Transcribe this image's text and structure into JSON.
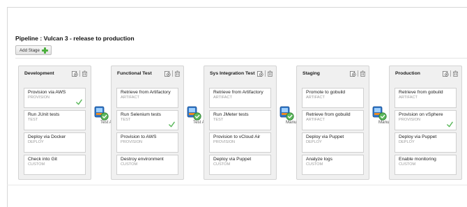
{
  "pipeline": {
    "title": "Pipeline : Vulcan 3 - release to production",
    "add_stage_label": "Add Stage"
  },
  "stages": [
    {
      "name": "Development",
      "tasks": [
        {
          "name": "Provision via AWS",
          "type": "PROVISION",
          "status": "success"
        },
        {
          "name": "Run JUnit tests",
          "type": "TEST",
          "status": ""
        },
        {
          "name": "Deploy via Docker",
          "type": "DEPLOY",
          "status": ""
        },
        {
          "name": "Check into Git",
          "type": "CUSTOM",
          "status": ""
        }
      ]
    },
    {
      "name": "Functional Test",
      "tasks": [
        {
          "name": "Retrieve from Artifactory",
          "type": "ARTIFACT",
          "status": ""
        },
        {
          "name": "Run Selenium tests",
          "type": "TEST",
          "status": "success"
        },
        {
          "name": "Provision to AWS",
          "type": "PROVISION",
          "status": ""
        },
        {
          "name": "Destroy environment",
          "type": "CUSTOM",
          "status": ""
        }
      ]
    },
    {
      "name": "Sys Integration Test",
      "tasks": [
        {
          "name": "Retrieve from Artifactory",
          "type": "ARTIFACT",
          "status": ""
        },
        {
          "name": "Run JMeter tests",
          "type": "TEST",
          "status": ""
        },
        {
          "name": "Provision to vCloud Air",
          "type": "PROVISION",
          "status": ""
        },
        {
          "name": "Deploy via Puppet",
          "type": "CUSTOM",
          "status": ""
        }
      ]
    },
    {
      "name": "Staging",
      "tasks": [
        {
          "name": "Promote to gobuild",
          "type": "ARTIFACT",
          "status": ""
        },
        {
          "name": "Retrieve from gobuild",
          "type": "ARTIFACT",
          "status": ""
        },
        {
          "name": "Deploy via Puppet",
          "type": "DEPLOY",
          "status": ""
        },
        {
          "name": "Analyze logs",
          "type": "CUSTOM",
          "status": ""
        }
      ]
    },
    {
      "name": "Production",
      "tasks": [
        {
          "name": "Retrieve from gobuild",
          "type": "ARTIFACT",
          "status": ""
        },
        {
          "name": "Provision on vSphere",
          "type": "PROVISION",
          "status": "success"
        },
        {
          "name": "Deploy via Puppet",
          "type": "DEPLOY",
          "status": ""
        },
        {
          "name": "Enable monitoring",
          "type": "CUSTOM",
          "status": ""
        }
      ]
    }
  ],
  "gates": [
    {
      "label": "Test A"
    },
    {
      "label": "Test A"
    },
    {
      "label": "Manu"
    },
    {
      "label": "Manu"
    }
  ],
  "colors": {
    "success": "#5cb85c",
    "gate_blue": "#2f76c7",
    "gate_orange": "#e98a24"
  }
}
